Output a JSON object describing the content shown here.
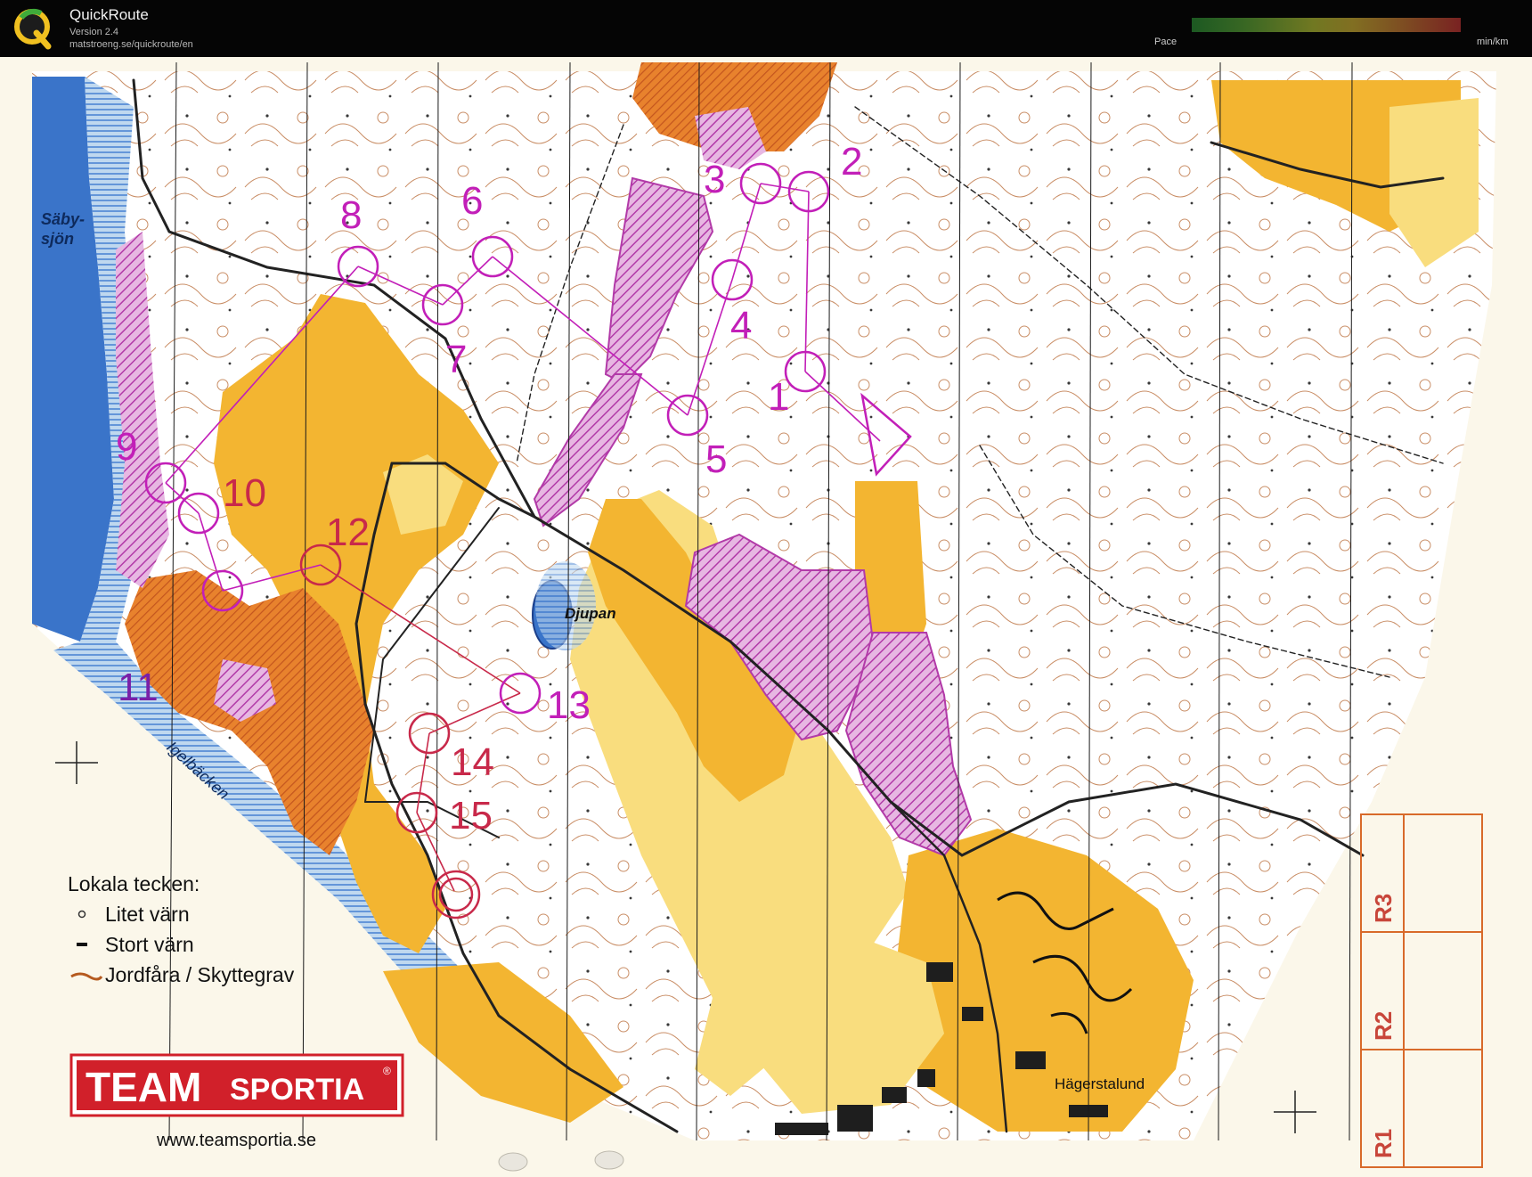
{
  "app": {
    "title": "QuickRoute",
    "version": "Version 2.4",
    "url": "matstroeng.se/quickroute/en",
    "logo_letter": "Q"
  },
  "pace": {
    "label": "Pace",
    "unit": "min/km"
  },
  "map": {
    "controls": [
      "1",
      "2",
      "3",
      "4",
      "5",
      "6",
      "7",
      "8",
      "9",
      "10",
      "11",
      "12",
      "13",
      "14",
      "15"
    ],
    "place_names": {
      "lake": "Säby-sjön",
      "lake_line1": "Säby-",
      "lake_line2": "sjön",
      "pond": "Djupan",
      "stream": "Igelbäcken",
      "village": "Hägerstalund"
    },
    "legend": {
      "title": "Lokala tecken:",
      "items": [
        "Litet värn",
        "Stort värn",
        "Jordfåra / Skyttegrav"
      ]
    },
    "sponsor": {
      "name_left": "TEAM",
      "name_right": "SPORTIA",
      "mark": "®",
      "url": "www.teamsportia.se"
    },
    "relay_boxes": [
      "R3",
      "R2",
      "R1"
    ]
  },
  "colors": {
    "course": "#c21fb8",
    "course_alt": "#d0203f",
    "open_land": "#f3b531",
    "rough_open": "#f9dd7e",
    "forest": "#ffffff",
    "contour": "#b86b3c",
    "water": "#2f6fc8",
    "forbidden": "#c54fbf",
    "brand_red": "#d1202a"
  }
}
